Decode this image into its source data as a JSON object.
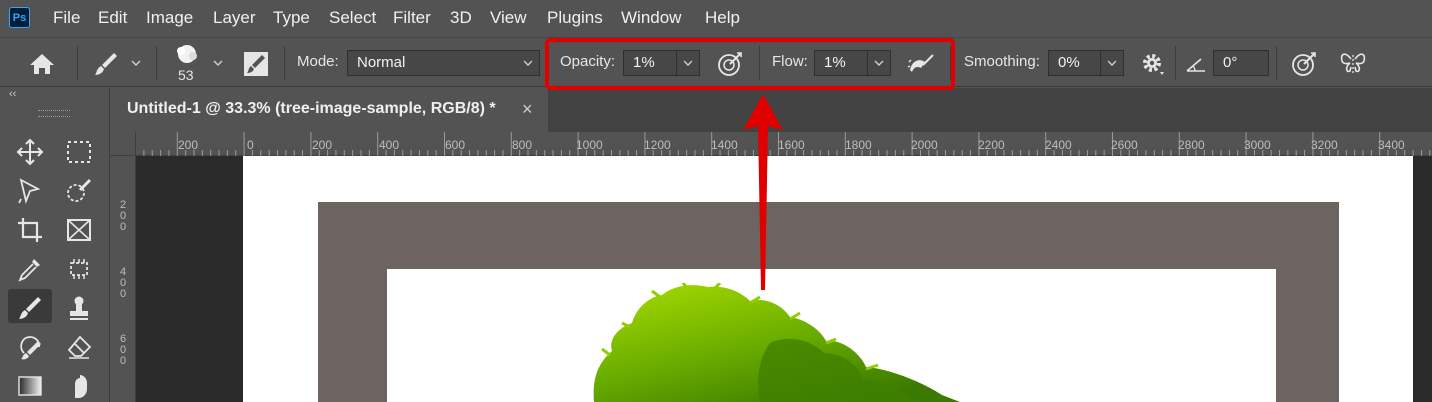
{
  "app": {
    "logo_text": "Ps"
  },
  "menu": [
    "File",
    "Edit",
    "Image",
    "Layer",
    "Type",
    "Select",
    "Filter",
    "3D",
    "View",
    "Plugins",
    "Window",
    "Help"
  ],
  "options_bar": {
    "brush_size": "53",
    "mode_label": "Mode:",
    "mode_value": "Normal",
    "opacity_label": "Opacity:",
    "opacity_value": "1%",
    "flow_label": "Flow:",
    "flow_value": "1%",
    "smoothing_label": "Smoothing:",
    "smoothing_value": "0%",
    "angle_value": "0°"
  },
  "panel_collapse": "‹‹",
  "document_tab": {
    "title": "Untitled-1 @ 33.3% (tree-image-sample, RGB/8) *",
    "close": "×"
  },
  "ruler_h_labels": [
    "200",
    "0",
    "200",
    "400",
    "600",
    "800",
    "1000",
    "1200",
    "1400",
    "1600",
    "1800",
    "2000",
    "2200",
    "2400",
    "2600",
    "2800",
    "3000",
    "3200",
    "3400"
  ],
  "ruler_v_labels": [
    "2 0 0",
    "4 0 0",
    "6 0 0"
  ],
  "colors": {
    "highlight": "#e10000",
    "tree_light": "#9ad400",
    "tree_dark": "#3f7f00"
  }
}
